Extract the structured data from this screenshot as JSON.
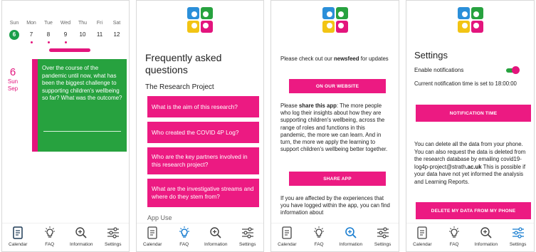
{
  "colors": {
    "pink": "#e3157d",
    "green": "#27a23f",
    "selected_day": "#1a9f4a"
  },
  "nav": {
    "calendar": "Calendar",
    "faq": "FAQ",
    "information": "Information",
    "settings": "Settings"
  },
  "calendar": {
    "days": [
      {
        "name": "Sun",
        "num": "6"
      },
      {
        "name": "Mon",
        "num": "7"
      },
      {
        "name": "Tue",
        "num": "8"
      },
      {
        "name": "Wed",
        "num": "9"
      },
      {
        "name": "Thu",
        "num": "10"
      },
      {
        "name": "Fri",
        "num": "11"
      },
      {
        "name": "Sat",
        "num": "12"
      }
    ],
    "big_date": {
      "num": "6",
      "day": "Sun",
      "month": "Sep"
    },
    "question": "Over the course of the pandemic until now, what has been the biggest challenge to supporting children's wellbeing so far? What was the outcome?"
  },
  "faq": {
    "title": "Frequently asked questions",
    "section": "The Research Project",
    "items": [
      "What is the aim of this research?",
      "Who created the COVID 4P Log?",
      "Who are the key partners involved in this research project?",
      "What are the investigative streams and where do they stem from?"
    ],
    "next_section": "App Use"
  },
  "information": {
    "p1_before": "Please check out our ",
    "p1_bold": "newsfeed",
    "p1_after": " for updates",
    "website_button": "ON OUR WEBSITE",
    "p2_before": "Please ",
    "p2_bold": "share this app",
    "p2_after": ": The more people who log their insights about how they are supporting children's wellbeing, across the range of roles and functions in this pandemic, the more we can learn. And in turn, the more we apply the learning to support children's wellbeing better together.",
    "share_button": "SHARE APP",
    "p3": "If you are affected by the experiences that you have logged within the app, you can find information about"
  },
  "settings": {
    "title": "Settings",
    "enable_label": "Enable notifications",
    "notifications_enabled": true,
    "time_text": "Current notification time is set to 18:00:00",
    "time_button": "NOTIFICATION TIME",
    "delete_before": "You can delete all the data from your phone. You can also request the data is deleted from the research database by emailing ",
    "delete_email_1": "covid19-log4p-project@strath",
    "delete_email_2": ".ac.uk",
    "delete_after": " This is possible if your data have not yet informed the analysis and Learning Reports.",
    "delete_button": "DELETE MY DATA FROM MY PHONE"
  }
}
